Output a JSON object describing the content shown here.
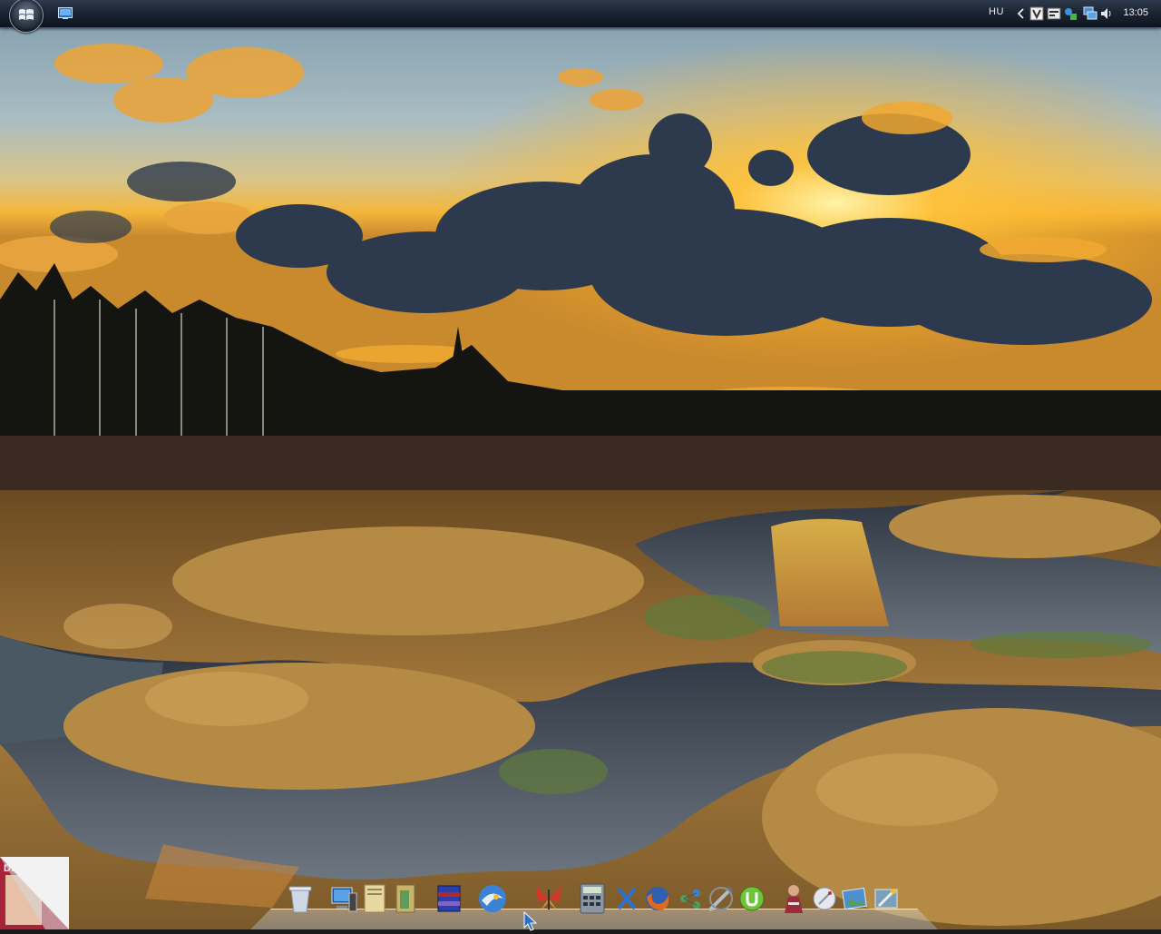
{
  "taskbar": {
    "language": "HU",
    "clock": "13:05",
    "tray_icons": [
      "chevron-left-icon",
      "shield-icon",
      "keyboard-icon",
      "network-status-icon",
      "monitor-network-icon",
      "speaker-icon"
    ]
  },
  "dock": {
    "icons": [
      {
        "name": "recycle-bin",
        "color": "#c9d6e4"
      },
      {
        "name": "computer",
        "color": "#3b77c9"
      },
      {
        "name": "documents-folder",
        "color": "#d8c48a"
      },
      {
        "name": "library-door",
        "color": "#6ea067"
      },
      {
        "name": "winrar-archive",
        "color": "#2c3fa8"
      },
      {
        "name": "thunderbird-mail",
        "color": "#3a82d6"
      },
      {
        "name": "butterfly-messenger",
        "color": "#d0382a"
      },
      {
        "name": "calculator",
        "color": "#8d96a3"
      },
      {
        "name": "xfire",
        "color": "#2f6fcf"
      },
      {
        "name": "firefox",
        "color": "#e06a1c"
      },
      {
        "name": "network-tool",
        "color": "#4aa05a"
      },
      {
        "name": "sword-game",
        "color": "#b5bcc6"
      },
      {
        "name": "utorrent",
        "color": "#6ec43b"
      },
      {
        "name": "game-character",
        "color": "#9b2a3a"
      },
      {
        "name": "satellite-dish",
        "color": "#c8ccd3"
      },
      {
        "name": "picture-viewer",
        "color": "#4f8fd0"
      },
      {
        "name": "settings-tools",
        "color": "#7aa0b8"
      }
    ]
  },
  "colors": {
    "sky_top": "#93aab8",
    "sunset": "#f5b02a",
    "cloud": "#2c3a4e",
    "water": "#5c6a74",
    "grass": "#a87a3a"
  }
}
